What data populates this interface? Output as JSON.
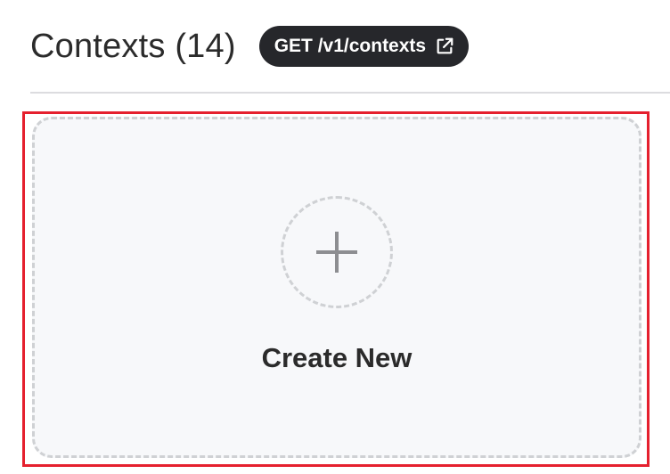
{
  "header": {
    "title": "Contexts (14)",
    "endpoint_label": "GET /v1/contexts",
    "endpoint_icon": "external-link-icon"
  },
  "create_card": {
    "label": "Create New",
    "icon": "plus-icon"
  },
  "colors": {
    "badge_background": "#26272b",
    "highlight": "#e5202e",
    "card_background": "#f7f8fa",
    "dashed_border": "#cfd1d4"
  }
}
